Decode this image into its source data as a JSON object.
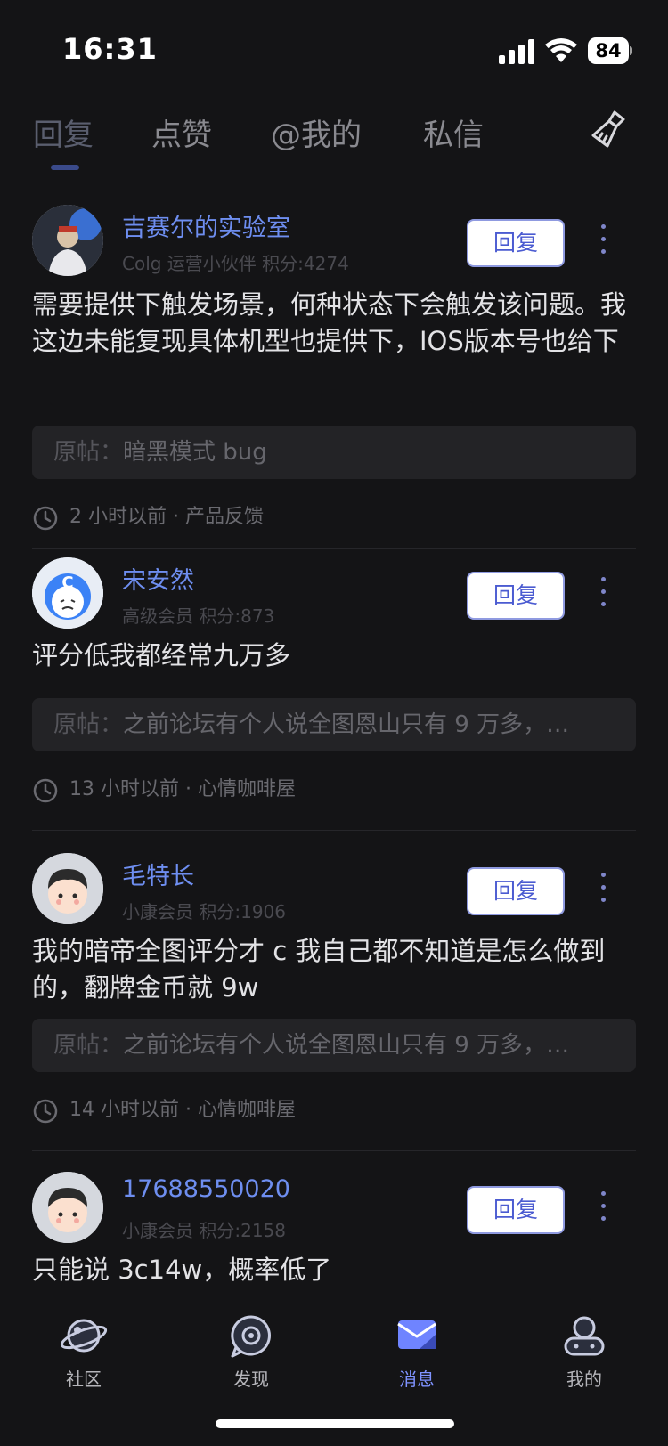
{
  "status_bar": {
    "time": "16:31",
    "battery": "84",
    "icons": [
      "signal-icon",
      "wifi-icon",
      "battery-icon"
    ]
  },
  "tabs": [
    {
      "label": "回复",
      "active": true
    },
    {
      "label": "点赞",
      "active": false
    },
    {
      "label": "@我的",
      "active": false
    },
    {
      "label": "私信",
      "active": false
    }
  ],
  "tab_action_icon": "broom-icon",
  "reply_button_label": "回复",
  "origin_label": "原帖：",
  "items": [
    {
      "username": "吉赛尔的实验室",
      "usermeta": "Colg 运营小伙伴 积分:4274",
      "content": "需要提供下触发场景，何种状态下会触发该问题。我这边未能复现具体机型也提供下，IOS版本号也给下",
      "origin": "暗黑模式 bug",
      "meta": "2 小时以前 · 产品反馈"
    },
    {
      "username": "宋安然",
      "usermeta": "高级会员 积分:873",
      "content": "评分低我都经常九万多",
      "origin": "之前论坛有个人说全图恩山只有 9 万多，…",
      "meta": "13 小时以前 · 心情咖啡屋"
    },
    {
      "username": "毛特长",
      "usermeta": "小康会员 积分:1906",
      "content": "我的暗帝全图评分才 c 我自己都不知道是怎么做到的，翻牌金币就 9w",
      "origin": "之前论坛有个人说全图恩山只有 9 万多，…",
      "meta": "14 小时以前 · 心情咖啡屋"
    },
    {
      "username": "17688550020",
      "usermeta": "小康会员 积分:2158",
      "content": "只能说 3c14w，概率低了",
      "origin": "",
      "meta": ""
    }
  ],
  "bottom_nav": [
    {
      "label": "社区",
      "icon": "planet-icon",
      "active": false
    },
    {
      "label": "发现",
      "icon": "discover-icon",
      "active": false
    },
    {
      "label": "消息",
      "icon": "message-icon",
      "active": true
    },
    {
      "label": "我的",
      "icon": "profile-icon",
      "active": false
    }
  ],
  "colors": {
    "background": "#141416",
    "accent": "#7f93ff",
    "username": "#6e8ef0"
  }
}
